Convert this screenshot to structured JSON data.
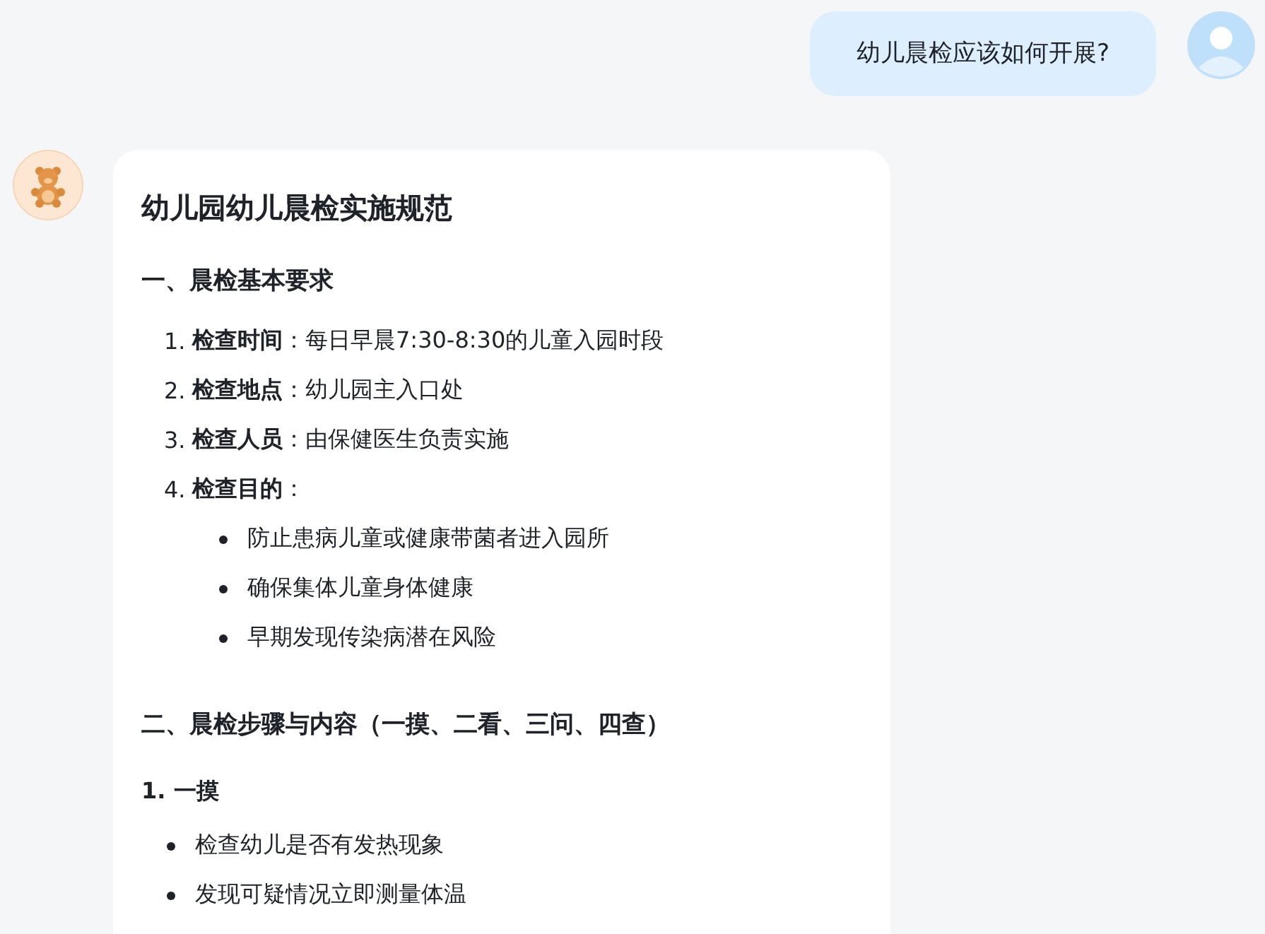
{
  "user_message": {
    "text": "幼儿晨检应该如何开展?"
  },
  "answer": {
    "title": "幼儿园幼儿晨检实施规范",
    "sections": [
      {
        "kind": "numbered",
        "heading": "一、晨检基本要求",
        "items": [
          {
            "number": "1.",
            "text": "**检查时间**：每日早晨7:30-8:30的儿童入园时段"
          },
          {
            "number": "2.",
            "text": "**检查地点**：幼儿园主入口处"
          },
          {
            "number": "3.",
            "text": "**检查人员**：由保健医生负责实施"
          },
          {
            "number": "4.",
            "text": "**检查目的**：",
            "bullets": [
              "防止患病儿童或健康带菌者进入园所",
              "确保集体儿童身体健康",
              "早期发现传染病潜在风险"
            ]
          }
        ]
      },
      {
        "kind": "steps",
        "heading": "二、晨检步骤与内容（一摸、二看、三问、四查）",
        "subsections": [
          {
            "heading": "1. 一摸",
            "bullets": [
              "检查幼儿是否有发热现象",
              "发现可疑情况立即测量体温"
            ]
          }
        ]
      }
    ]
  }
}
